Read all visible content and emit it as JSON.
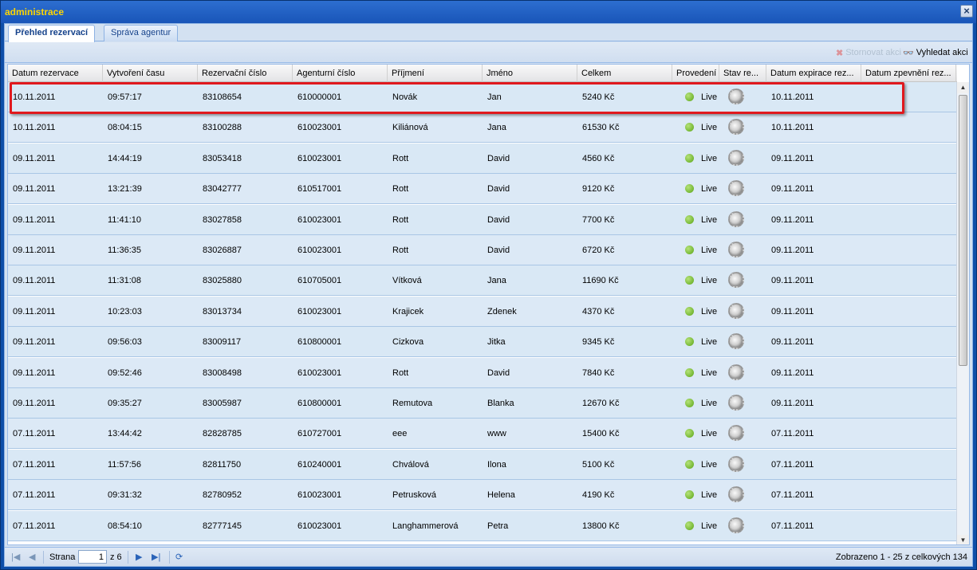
{
  "window": {
    "title": "administrace",
    "close_icon": "close-icon"
  },
  "tabs": [
    {
      "label": "Přehled rezervací",
      "active": true
    },
    {
      "label": "Správa agentur",
      "active": false
    }
  ],
  "toolbar": {
    "disabled_label": "Stornovat akci",
    "search_label": "Vyhledat akci"
  },
  "columns": [
    "Datum rezervace",
    "Vytvoření času",
    "Rezervační číslo",
    "Agenturní číslo",
    "Příjmení",
    "Jméno",
    "Celkem",
    "Provedení",
    "Stav re...",
    "Datum expirace rez...",
    "Datum zpevnění rez..."
  ],
  "rows": [
    [
      "10.11.2011",
      "09:57:17",
      "83108654",
      "610000001",
      "Novák",
      "Jan",
      "5240 Kč",
      "Live",
      "10.11.2011"
    ],
    [
      "10.11.2011",
      "08:04:15",
      "83100288",
      "610023001",
      "Kiliánová",
      "Jana",
      "61530 Kč",
      "Live",
      "10.11.2011"
    ],
    [
      "09.11.2011",
      "14:44:19",
      "83053418",
      "610023001",
      "Rott",
      "David",
      "4560 Kč",
      "Live",
      "09.11.2011"
    ],
    [
      "09.11.2011",
      "13:21:39",
      "83042777",
      "610517001",
      "Rott",
      "David",
      "9120 Kč",
      "Live",
      "09.11.2011"
    ],
    [
      "09.11.2011",
      "11:41:10",
      "83027858",
      "610023001",
      "Rott",
      "David",
      "7700 Kč",
      "Live",
      "09.11.2011"
    ],
    [
      "09.11.2011",
      "11:36:35",
      "83026887",
      "610023001",
      "Rott",
      "David",
      "6720 Kč",
      "Live",
      "09.11.2011"
    ],
    [
      "09.11.2011",
      "11:31:08",
      "83025880",
      "610705001",
      "Vítková",
      "Jana",
      "11690 Kč",
      "Live",
      "09.11.2011"
    ],
    [
      "09.11.2011",
      "10:23:03",
      "83013734",
      "610023001",
      "Krajicek",
      "Zdenek",
      "4370 Kč",
      "Live",
      "09.11.2011"
    ],
    [
      "09.11.2011",
      "09:56:03",
      "83009117",
      "610800001",
      "Cizkova",
      "Jitka",
      "9345 Kč",
      "Live",
      "09.11.2011"
    ],
    [
      "09.11.2011",
      "09:52:46",
      "83008498",
      "610023001",
      "Rott",
      "David",
      "7840 Kč",
      "Live",
      "09.11.2011"
    ],
    [
      "09.11.2011",
      "09:35:27",
      "83005987",
      "610800001",
      "Remutova",
      "Blanka",
      "12670 Kč",
      "Live",
      "09.11.2011"
    ],
    [
      "07.11.2011",
      "13:44:42",
      "82828785",
      "610727001",
      "eee",
      "www",
      "15400 Kč",
      "Live",
      "07.11.2011"
    ],
    [
      "07.11.2011",
      "11:57:56",
      "82811750",
      "610240001",
      "Chválová",
      "Ilona",
      "5100 Kč",
      "Live",
      "07.11.2011"
    ],
    [
      "07.11.2011",
      "09:31:32",
      "82780952",
      "610023001",
      "Petrusková",
      "Helena",
      "4190 Kč",
      "Live",
      "07.11.2011"
    ],
    [
      "07.11.2011",
      "08:54:10",
      "82777145",
      "610023001",
      "Langhammerová",
      "Petra",
      "13800 Kč",
      "Live",
      "07.11.2011"
    ]
  ],
  "pager": {
    "page_label": "Strana",
    "page_value": "1",
    "of_label": "z 6",
    "info": "Zobrazeno 1 - 25 z celkových 134"
  },
  "colors": {
    "live": "#5aa516",
    "highlight": "#e0191e",
    "title_text": "#ffd700"
  }
}
